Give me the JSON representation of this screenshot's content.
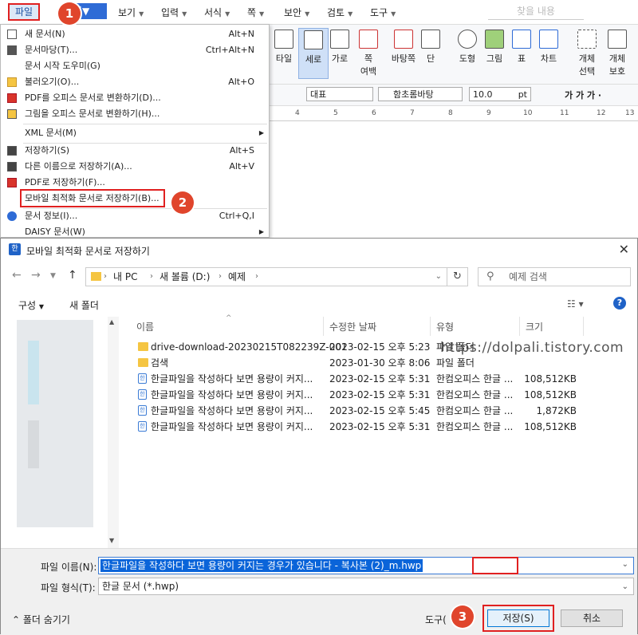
{
  "menubar": {
    "items": [
      "파일",
      "편집",
      "보기",
      "입력",
      "서식",
      "쪽",
      "보안",
      "검토",
      "도구"
    ],
    "edit_short": "집",
    "search_placeholder": "찾을 내용"
  },
  "markers": [
    "1",
    "2",
    "3"
  ],
  "ribbon": {
    "partial_left": "타일",
    "buttons": [
      {
        "label": "세로",
        "selected": true
      },
      {
        "label": "가로"
      },
      {
        "label": "쪽\n여백"
      },
      {
        "label": "바탕쪽"
      },
      {
        "label": "단"
      },
      {
        "label": "도형"
      },
      {
        "label": "그림"
      },
      {
        "label": "표"
      },
      {
        "label": "차트"
      },
      {
        "label": "개체\n선택"
      },
      {
        "label": "개체\n보호"
      }
    ]
  },
  "formatbar": {
    "style": "대표",
    "font": "함초롬바탕",
    "size": "10.0",
    "unit": "pt",
    "format_chars": "가 가 가 ·"
  },
  "ruler": {
    "ticks": [
      "4",
      "5",
      "6",
      "7",
      "8",
      "9",
      "10",
      "11",
      "12",
      "13"
    ]
  },
  "file_menu": {
    "items": [
      {
        "label": "새 문서(N)",
        "shortcut": "Alt+N",
        "icon": "new-doc-icon"
      },
      {
        "label": "문서마당(T)...",
        "shortcut": "Ctrl+Alt+N",
        "icon": "template-icon"
      },
      {
        "label": "문서 시작 도우미(G)",
        "shortcut": "",
        "icon": ""
      },
      {
        "label": "불러오기(O)...",
        "shortcut": "Alt+O",
        "icon": "open-folder-icon"
      },
      {
        "label": "PDF를 오피스 문서로 변환하기(D)...",
        "shortcut": "",
        "icon": "pdf-icon"
      },
      {
        "label": "그림을 오피스 문서로 변환하기(H)...",
        "shortcut": "",
        "icon": "image-convert-icon"
      },
      {
        "label": "XML 문서(M)",
        "shortcut": "",
        "icon": "",
        "submenu": true
      },
      {
        "label": "저장하기(S)",
        "shortcut": "Alt+S",
        "icon": "save-icon"
      },
      {
        "label": "다른 이름으로 저장하기(A)...",
        "shortcut": "Alt+V",
        "icon": "save-as-icon"
      },
      {
        "label": "PDF로 저장하기(F)...",
        "shortcut": "",
        "icon": "pdf-save-icon"
      },
      {
        "label": "모바일 최적화 문서로 저장하기(B)...",
        "shortcut": "",
        "icon": ""
      },
      {
        "label": "문서 정보(I)...",
        "shortcut": "Ctrl+Q,I",
        "icon": "info-icon"
      },
      {
        "label": "DAISY 문서(W)",
        "shortcut": "",
        "icon": "",
        "submenu": true
      }
    ]
  },
  "dialog": {
    "title": "모바일 최적화 문서로 저장하기",
    "app_icon": "한",
    "close": "✕",
    "breadcrumb": [
      "내 PC",
      "새 볼륨 (D:)",
      "예제"
    ],
    "search_placeholder": "예제 검색",
    "toolbar": {
      "organize": "구성",
      "new_folder": "새 폴더"
    },
    "columns": [
      "이름",
      "수정한 날짜",
      "유형",
      "크기"
    ],
    "files": [
      {
        "name": "drive-download-20230215T082239Z-001",
        "date": "2023-02-15 오후 5:23",
        "type": "파일 폴더",
        "size": "",
        "kind": "folder"
      },
      {
        "name": "검색",
        "date": "2023-01-30 오후 8:06",
        "type": "파일 폴더",
        "size": "",
        "kind": "folder"
      },
      {
        "name": "한글파일을 작성하다 보면 용량이 커지...",
        "date": "2023-02-15 오후 5:31",
        "type": "한컴오피스 한글 ...",
        "size": "108,512KB",
        "kind": "hwp"
      },
      {
        "name": "한글파일을 작성하다 보면 용량이 커지...",
        "date": "2023-02-15 오후 5:31",
        "type": "한컴오피스 한글 ...",
        "size": "108,512KB",
        "kind": "hwp"
      },
      {
        "name": "한글파일을 작성하다 보면 용량이 커지...",
        "date": "2023-02-15 오후 5:45",
        "type": "한컴오피스 한글 ...",
        "size": "1,872KB",
        "kind": "hwp"
      },
      {
        "name": "한글파일을 작성하다 보면 용량이 커지...",
        "date": "2023-02-15 오후 5:31",
        "type": "한컴오피스 한글 ...",
        "size": "108,512KB",
        "kind": "hwp"
      }
    ],
    "filename_label": "파일 이름(N):",
    "filename_value": "한글파일을 작성하다 보면 용량이 커지는 경우가 있습니다 - 복사본 (2)_m.hwp",
    "filetype_label": "파일 형식(T):",
    "filetype_value": "한글 문서 (*.hwp)",
    "hide_folders": "폴더 숨기기",
    "tools": "도구(",
    "save": "저장(S)",
    "cancel": "취소"
  },
  "watermark": "https://dolpali.tistory.com"
}
